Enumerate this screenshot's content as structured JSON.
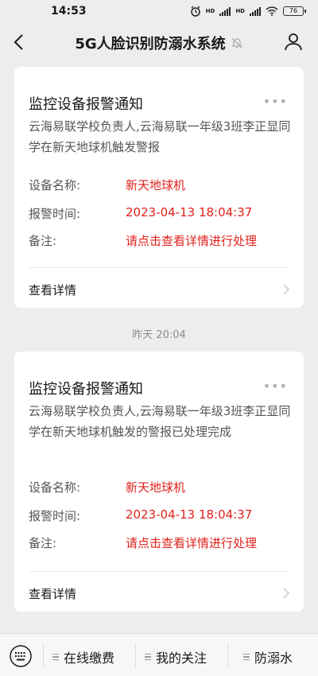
{
  "status_bar": {
    "time": "14:53",
    "battery": "76",
    "network_tag": "HD"
  },
  "nav": {
    "title": "5G人脸识别防溺水系统"
  },
  "cards": [
    {
      "title": "监控设备报警通知",
      "more": "•••",
      "description": "云海易联学校负责人,云海易联一年级3班李正显同学在新天地球机触发警报",
      "fields": [
        {
          "label": "设备名称:",
          "value": "新天地球机"
        },
        {
          "label": "报警时间:",
          "value": "2023-04-13 18:04:37"
        },
        {
          "label": "备注:",
          "value": "请点击查看详情进行处理"
        }
      ],
      "link": "查看详情"
    },
    {
      "title": "监控设备报警通知",
      "more": "•••",
      "description": "云海易联学校负责人,云海易联一年级3班李正显同学在新天地球机触发的警报已处理完成",
      "fields": [
        {
          "label": "设备名称:",
          "value": "新天地球机"
        },
        {
          "label": "报警时间:",
          "value": "2023-04-13 18:04:37"
        },
        {
          "label": "备注:",
          "value": "请点击查看详情进行处理"
        }
      ],
      "link": "查看详情"
    }
  ],
  "timestamp": "昨天 20:04",
  "bottom_menu": {
    "items": [
      "在线缴费",
      "我的关注",
      "防溺水"
    ]
  },
  "colors": {
    "accent_red": "#e0211b",
    "background": "#ededed"
  },
  "icons": [
    "back-arrow-icon",
    "mute-bell-icon",
    "user-icon",
    "keyboard-icon",
    "chevron-right-icon"
  ]
}
